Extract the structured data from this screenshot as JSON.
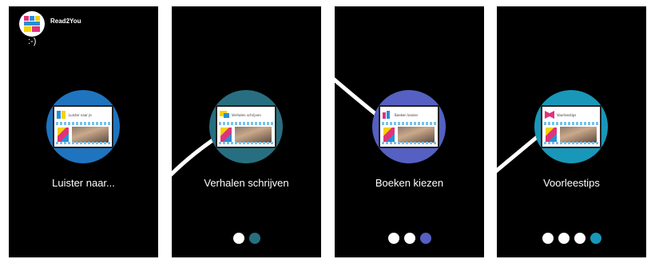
{
  "app": {
    "name": "Read2You",
    "status_text": ":-)"
  },
  "screens": [
    {
      "label": "Luister naar...",
      "circle_color": "#1f74bf",
      "card_caption": "Luister naar je",
      "dots_total": 0,
      "dots_active": 0
    },
    {
      "label": "Verhalen schrijven",
      "circle_color": "#276f80",
      "card_caption": "Verhalen schrijven",
      "dots_total": 2,
      "dots_active": 2
    },
    {
      "label": "Boeken kiezen",
      "circle_color": "#5560c2",
      "card_caption": "Boeken kiezen",
      "dots_total": 3,
      "dots_active": 3
    },
    {
      "label": "Voorleestips",
      "circle_color": "#1997b8",
      "card_caption": "Voorleestips",
      "dots_total": 4,
      "dots_active": 4
    }
  ],
  "colors": {
    "background": "#000000",
    "frame": "#ffffff",
    "dot_inactive": "#ffffff"
  },
  "icons": {
    "app_logo": "read2you-logo-icon"
  }
}
